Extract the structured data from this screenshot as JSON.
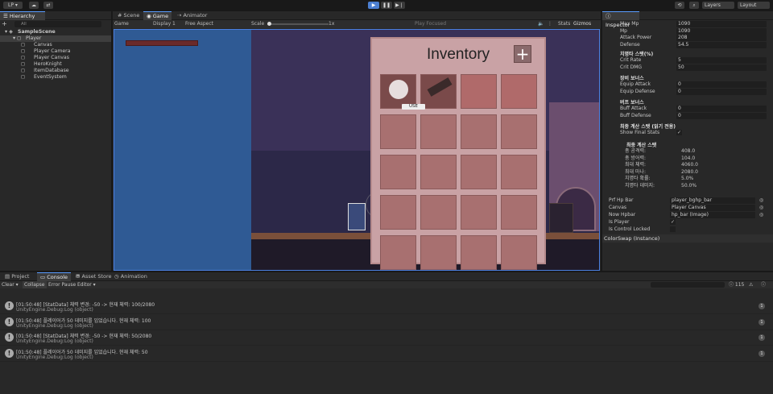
{
  "topbar": {
    "account": "LP ▾",
    "layers": "Layers",
    "layout": "Layout",
    "play_icon": "play-icon",
    "pause_icon": "pause-icon",
    "step_icon": "step-icon"
  },
  "hierarchy": {
    "tab": "Hierarchy",
    "search_placeholder": "All",
    "items": [
      {
        "label": "SampleScene",
        "indent": 0
      },
      {
        "label": "Player",
        "indent": 1
      },
      {
        "label": "Canvas",
        "indent": 2
      },
      {
        "label": "Player Camera",
        "indent": 2
      },
      {
        "label": "Player Canvas",
        "indent": 2
      },
      {
        "label": "HeroKnight",
        "indent": 2
      },
      {
        "label": "ItemDatabase",
        "indent": 2
      },
      {
        "label": "EventSystem",
        "indent": 2
      }
    ]
  },
  "center": {
    "tabs": [
      "Scene",
      "Game",
      "Animator"
    ],
    "game_label": "Game",
    "display": "Display 1",
    "aspect": "Free Aspect",
    "scale_label": "Scale",
    "scale_value": "1x",
    "play_focused": "Play Focused",
    "stats": "Stats",
    "gizmos": "Gizmos",
    "inventory_title": "Inventory",
    "add_symbol": "+",
    "slot_badge": "USE"
  },
  "inspector": {
    "tab": "Inspector",
    "fields1": [
      {
        "label": "Max Mp",
        "value": "1090"
      },
      {
        "label": "Mp",
        "value": "1090"
      },
      {
        "label": "Attack Power",
        "value": "208"
      },
      {
        "label": "Defense",
        "value": "54.5"
      }
    ],
    "sec_crit": "치명타 스탯(%)",
    "fields_crit": [
      {
        "label": "Crit Rate",
        "value": "5"
      },
      {
        "label": "Crit DMG",
        "value": "50"
      }
    ],
    "sec_equip": "장비 보너스",
    "fields_equip": [
      {
        "label": "Equip Attack",
        "value": "0"
      },
      {
        "label": "Equip Defense",
        "value": "0"
      }
    ],
    "sec_buff": "버프 보너스",
    "fields_buff": [
      {
        "label": "Buff Attack",
        "value": "0"
      },
      {
        "label": "Buff Defense",
        "value": "0"
      }
    ],
    "sec_final": "최종 계산 스탯 (읽기 전용)",
    "show_final": "Show Final Stats",
    "final_title": "최종 계산 스탯",
    "final_stats": [
      {
        "label": "총 공격력:",
        "value": "408.0"
      },
      {
        "label": "총 방어력:",
        "value": "104.0"
      },
      {
        "label": "최대 체력:",
        "value": "4060.0"
      },
      {
        "label": "최대 마나:",
        "value": "2080.0"
      },
      {
        "label": "치명타 확률:",
        "value": "5.0%"
      },
      {
        "label": "치명타 데미지:",
        "value": "50.0%"
      }
    ],
    "refs": [
      {
        "label": "Prf Hp Bar",
        "value": "player_bghp_bar"
      },
      {
        "label": "Canvas",
        "value": "Player Canvas"
      },
      {
        "label": "Now Hpbar",
        "value": "hp_bar (Image)"
      }
    ],
    "is_player": "Is Player",
    "is_control_locked": "Is Control Locked",
    "component": "ColorSwap (Instance)"
  },
  "console": {
    "tabs": [
      "Project",
      "Console",
      "Asset Store",
      "Animation"
    ],
    "toolbar": [
      "Clear ▾",
      "Collapse",
      "Error Pause",
      "Editor ▾"
    ],
    "count": "115",
    "rows": [
      {
        "time": "[01:50:48] [StatData] 체력 변경: -50 -> 현재 체력: 100/2080",
        "src": "UnityEngine.Debug:Log (object)"
      },
      {
        "time": "[01:50:48] 플레이어가 50 데미지를 입었습니다. 현재 체력: 100",
        "src": "UnityEngine.Debug:Log (object)"
      },
      {
        "time": "[01:50:48] [StatData] 체력 변경: -50 -> 현재 체력: 50/2080",
        "src": "UnityEngine.Debug:Log (object)"
      },
      {
        "time": "[01:50:48] 플레이어가 50 데미지를 입었습니다. 현재 체력: 50",
        "src": "UnityEngine.Debug:Log (object)"
      }
    ]
  }
}
